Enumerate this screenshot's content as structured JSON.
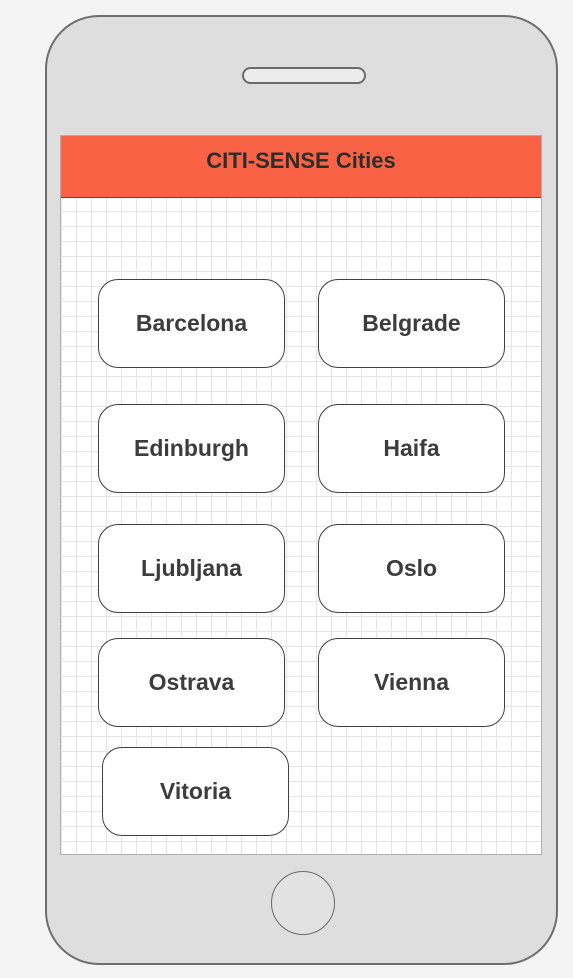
{
  "header": {
    "title": "CITI-SENSE Cities"
  },
  "cities": [
    {
      "label": "Barcelona"
    },
    {
      "label": "Belgrade"
    },
    {
      "label": "Edinburgh"
    },
    {
      "label": "Haifa"
    },
    {
      "label": "Ljubljana"
    },
    {
      "label": "Oslo"
    },
    {
      "label": "Ostrava"
    },
    {
      "label": "Vienna"
    },
    {
      "label": "Vitoria"
    }
  ],
  "colors": {
    "header_background": "#f96244",
    "phone_body": "#dedede",
    "screen_background": "#ffffff",
    "button_border": "#3f3f3f"
  }
}
